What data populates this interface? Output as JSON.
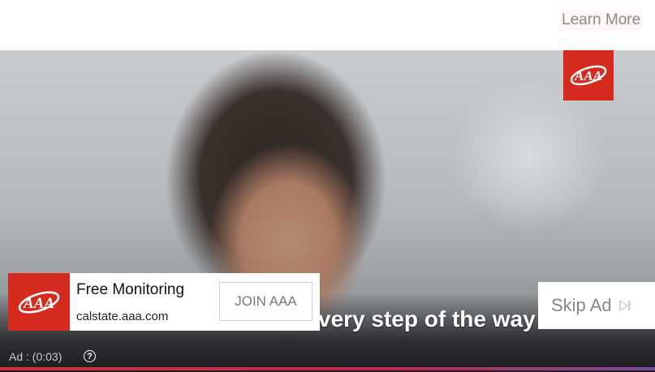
{
  "ad": {
    "learn_more": "Learn More",
    "caption": "very step of the way",
    "card": {
      "title": "Free Monitoring",
      "url": "calstate.aaa.com",
      "cta": "JOIN AAA"
    },
    "skip_label": "Skip Ad",
    "timer": "Ad : (0:03)",
    "help_glyph": "?"
  },
  "icons": {
    "brand_logo": "aaa-logo-icon",
    "skip": "skip-next-icon",
    "help": "help-circle-icon"
  },
  "colors": {
    "brand_red": "#d52b1e",
    "progress": "#d62f3a",
    "skip_text": "#888888"
  }
}
